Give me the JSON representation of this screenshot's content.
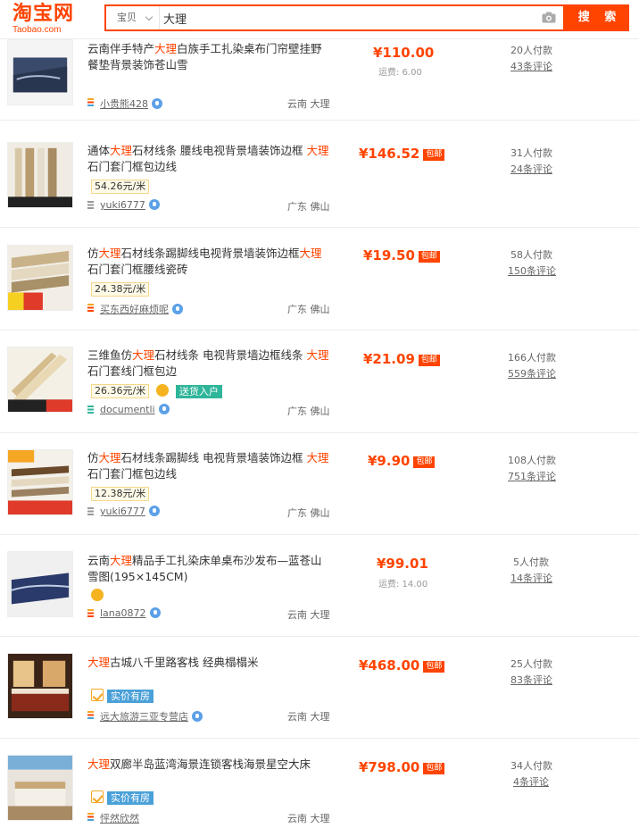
{
  "header": {
    "logo_main": "淘宝网",
    "logo_sub": "Taobao.com",
    "category": "宝贝",
    "query": "大理",
    "search_button": "搜 索"
  },
  "items": [
    {
      "title_pre": "云南伴手特产",
      "title_hl": "大理",
      "title_post": "白族手工扎染桌布门帘壁挂野餐垫背景装饰苍山雪",
      "price": "¥110.00",
      "shipping": "运费: 6.00",
      "shop": "小贵熊428",
      "location": "云南 大理",
      "sales": "20人付款",
      "reviews": "43条评论"
    },
    {
      "title_pre": "通体",
      "title_hl": "大理",
      "title_mid": "石材线条 腰线电视背景墙装饰边框 ",
      "title_hl2": "大理",
      "title_post": "石门套门框包边线",
      "unit_price": "54.26元/米",
      "price": "¥146.52",
      "baoyou": "包邮",
      "shop": "yuki6777",
      "location": "广东 佛山",
      "sales": "31人付款",
      "reviews": "24条评论"
    },
    {
      "title_pre": "仿",
      "title_hl": "大理",
      "title_mid": "石材线条踢脚线电视背景墙装饰边框",
      "title_hl2": "大理",
      "title_post": "石门套门框腰线瓷砖",
      "unit_price": "24.38元/米",
      "price": "¥19.50",
      "baoyou": "包邮",
      "shop": "买东西好麻烦呢",
      "location": "广东 佛山",
      "sales": "58人付款",
      "reviews": "150条评论"
    },
    {
      "title_pre": "三维鱼仿",
      "title_hl": "大理",
      "title_mid": "石材线条 电视背景墙边框线条 ",
      "title_hl2": "大理",
      "title_post": "石门套线门框包边",
      "unit_price": "26.36元/米",
      "tag": "送货入户",
      "price": "¥21.09",
      "baoyou": "包邮",
      "shop": "documentli",
      "location": "广东 佛山",
      "sales": "166人付款",
      "reviews": "559条评论"
    },
    {
      "title_pre": "仿",
      "title_hl": "大理",
      "title_mid": "石材线条踢脚线 电视背景墙装饰边框 ",
      "title_hl2": "大理",
      "title_post": "石门套门框包边线",
      "unit_price": "12.38元/米",
      "price": "¥9.90",
      "baoyou": "包邮",
      "shop": "yuki6777",
      "location": "广东 佛山",
      "sales": "108人付款",
      "reviews": "751条评论"
    },
    {
      "title_pre": "云南",
      "title_hl": "大理",
      "title_post": "精品手工扎染床单桌布沙发布—蓝苍山雪图(195×145CM)",
      "price": "¥99.01",
      "shipping": "运费: 14.00",
      "shop": "lana0872",
      "location": "云南 大理",
      "sales": "5人付款",
      "reviews": "14条评论"
    },
    {
      "title_pre": "",
      "title_hl": "大理",
      "title_post": "古城八千里路客栈 经典榻榻米",
      "tag": "实价有房",
      "price": "¥468.00",
      "baoyou": "包邮",
      "shop": "远大旅游三亚专营店",
      "location": "云南 大理",
      "sales": "25人付款",
      "reviews": "83条评论"
    },
    {
      "title_pre": "",
      "title_hl": "大理",
      "title_post": "双廊半岛蓝湾海景连锁客栈海景星空大床",
      "tag": "实价有房",
      "price": "¥798.00",
      "baoyou": "包邮",
      "shop": "怦然欣然",
      "location": "云南 大理",
      "sales": "34人付款",
      "reviews": "4条评论"
    }
  ],
  "colors": {
    "accent": "#ff4400",
    "wangwang": "#5ba0e8",
    "tag_blue": "#4aa0d8",
    "tag_green": "#2fb59a"
  }
}
